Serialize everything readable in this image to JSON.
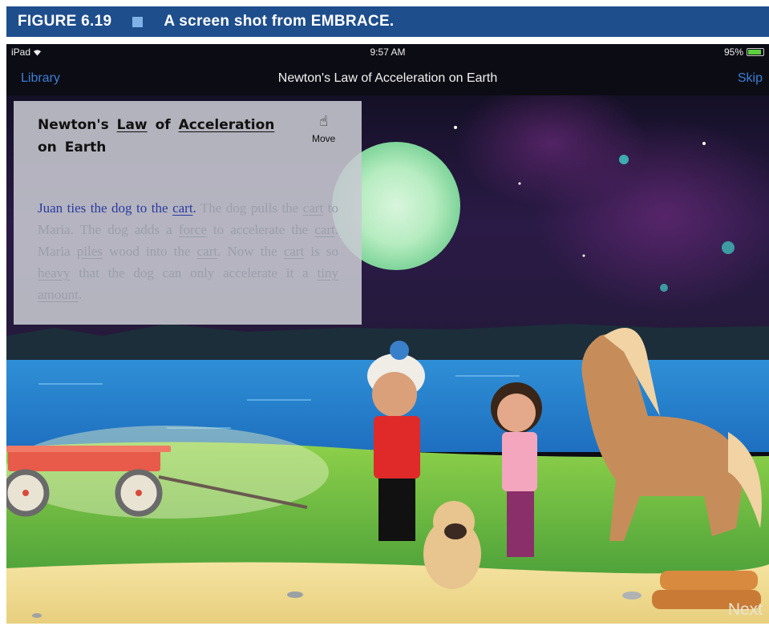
{
  "figure": {
    "label": "FIGURE 6.19",
    "caption": "A screen shot from EMBRACE."
  },
  "status_bar": {
    "device": "iPad",
    "wifi_icon": "wifi-icon",
    "time": "9:57 AM",
    "battery": "95%",
    "battery_level": 0.95
  },
  "nav_bar": {
    "back_label": "Library",
    "title": "Newton's Law of Acceleration on Earth",
    "skip_label": "Skip"
  },
  "text_panel": {
    "title_1": "Newton's",
    "title_2": "Law",
    "title_3": "of",
    "title_4": "Acceleration",
    "title_5": "on Earth",
    "move_icon": "hand-pointer-icon",
    "move_label": "Move",
    "sentences": {
      "s1_a": "Juan ties the dog to the ",
      "s1_b": "cart",
      "s1_c": ".",
      "s2_a": " The dog pulls the ",
      "s2_b": "cart",
      "s2_c": " to Maria.",
      "s3_a": " The dog adds a ",
      "s3_b": "force",
      "s3_c": " to accelerate the ",
      "s3_d": "cart",
      "s3_e": ".",
      "s4_a": " Maria ",
      "s4_b": "piles",
      "s4_c": " wood into the ",
      "s4_d": "cart",
      "s4_e": ".",
      "s5_a": " Now the ",
      "s5_b": "cart",
      "s5_c": " is so ",
      "s5_d": "heavy",
      "s5_e": " that the dog can only accelerate it a ",
      "s5_f": "tiny",
      "s5_g": " ",
      "s5_h": "amount",
      "s5_i": "."
    }
  },
  "next_label": "Next",
  "colors": {
    "figure_bar": "#1f4e8c",
    "nav_link": "#3a7fd6",
    "active_sentence": "#2a3aa0",
    "inactive_sentence": "#9b9eab"
  }
}
